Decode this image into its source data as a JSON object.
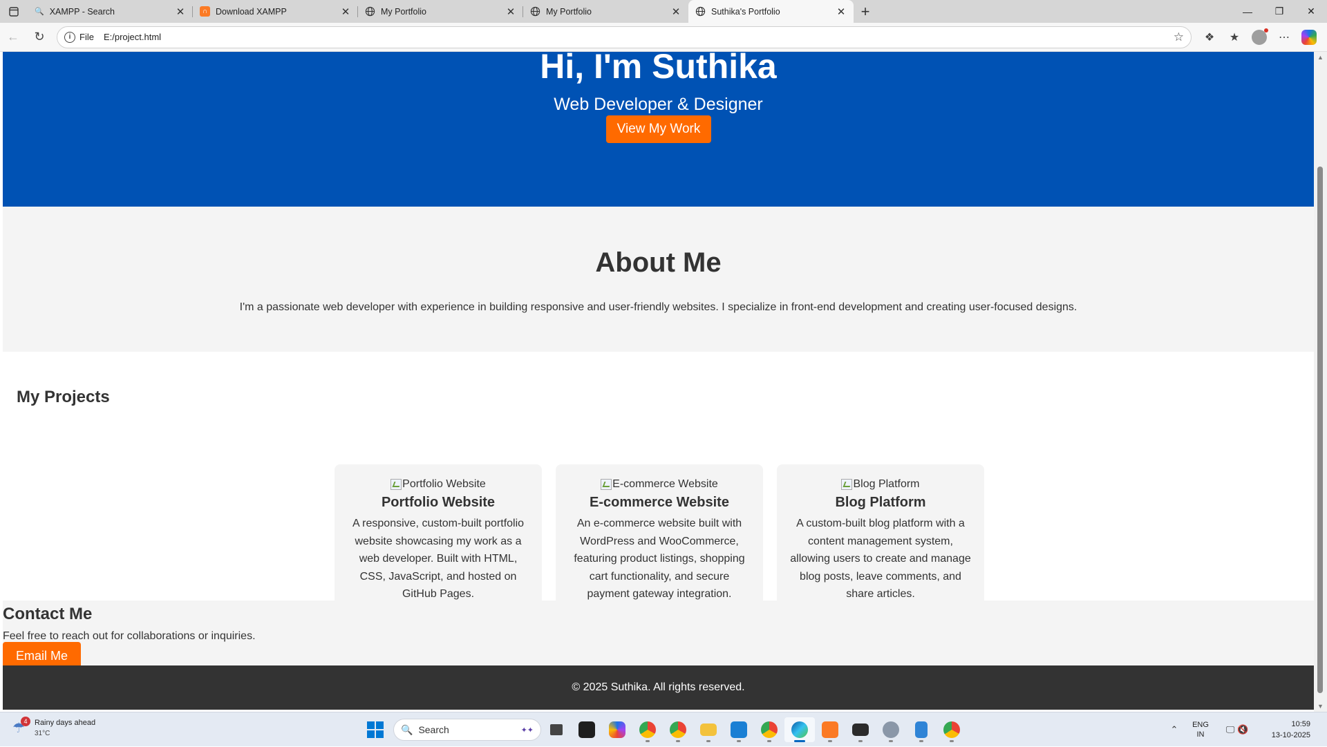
{
  "browser": {
    "tabs": [
      {
        "title": "XAMPP - Search",
        "icon": "search-icon",
        "active": false
      },
      {
        "title": "Download XAMPP",
        "icon": "xampp-icon",
        "active": false
      },
      {
        "title": "My Portfolio",
        "icon": "globe-icon",
        "active": false
      },
      {
        "title": "My Portfolio",
        "icon": "globe-icon",
        "active": false
      },
      {
        "title": "Suthika's Portfolio",
        "icon": "globe-icon",
        "active": true
      }
    ],
    "address": {
      "scheme": "File",
      "url": "E:/project.html"
    }
  },
  "page": {
    "hero": {
      "title": "Hi, I'm Suthika",
      "subtitle": "Web Developer & Designer",
      "cta_label": "View My Work",
      "bg_color": "#0052b4",
      "accent_color": "#ff6a00"
    },
    "about": {
      "heading": "About Me",
      "text": "I'm a passionate web developer with experience in building responsive and user-friendly websites. I specialize in front-end development and creating user-focused designs."
    },
    "projects": {
      "heading": "My Projects",
      "items": [
        {
          "img_alt": "Portfolio Website",
          "title": "Portfolio Website",
          "description": "A responsive, custom-built portfolio website showcasing my work as a web developer. Built with HTML, CSS, JavaScript, and hosted on GitHub Pages."
        },
        {
          "img_alt": "E-commerce Website",
          "title": "E-commerce Website",
          "description": "An e-commerce website built with WordPress and WooCommerce, featuring product listings, shopping cart functionality, and secure payment gateway integration."
        },
        {
          "img_alt": "Blog Platform",
          "title": "Blog Platform",
          "description": "A custom-built blog platform with a content management system, allowing users to create and manage blog posts, leave comments, and share articles."
        }
      ]
    },
    "contact": {
      "heading": "Contact Me",
      "text": "Feel free to reach out for collaborations or inquiries.",
      "button_label": "Email Me"
    },
    "footer": {
      "text": "© 2025 Suthika. All rights reserved."
    }
  },
  "taskbar": {
    "weather": {
      "badge": "4",
      "text": "Rainy days ahead",
      "temp": "31°C"
    },
    "search_placeholder": "Search",
    "tray": {
      "lang1": "ENG",
      "lang2": "IN",
      "time": "10:59",
      "date": "13-10-2025"
    }
  }
}
